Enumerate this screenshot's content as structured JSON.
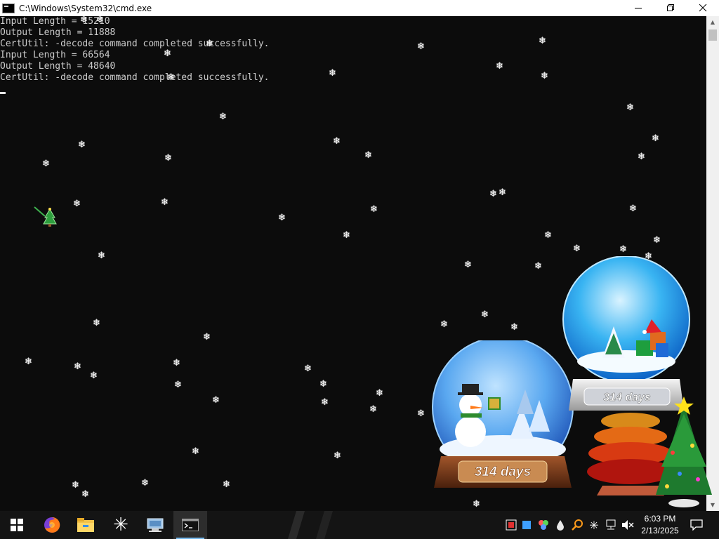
{
  "window": {
    "title": "C:\\Windows\\System32\\cmd.exe",
    "minimize_icon": "minimize-icon",
    "maximize_icon": "restore-icon",
    "close_icon": "close-icon"
  },
  "console": {
    "lines": [
      "Input Length = 15210",
      "Output Length = 11888",
      "CertUtil: -decode command completed successfully.",
      "Input Length = 66564",
      "Output Length = 48640",
      "CertUtil: -decode command completed successfully."
    ]
  },
  "gadgets": {
    "snowglobe_small": {
      "counter": "314 days"
    },
    "snowglobe_large": {
      "counter": "314 days"
    }
  },
  "taskbar": {
    "start_icon": "windows-start-icon",
    "apps": [
      {
        "icon": "firefox-icon"
      },
      {
        "icon": "file-explorer-icon"
      },
      {
        "icon": "snowflake-app-icon"
      },
      {
        "icon": "control-panel-icon"
      },
      {
        "icon": "command-prompt-icon"
      }
    ],
    "tray_icons": [
      "network-monitor-icon",
      "blue-square-icon",
      "colorful-app-icon",
      "water-drop-icon",
      "search-magnifier-icon",
      "snowflake-tray-icon",
      "network-icon",
      "volume-muted-icon"
    ],
    "time": "6:03 PM",
    "date": "2/13/2025",
    "notification_icon": "action-center-icon"
  },
  "colors": {
    "console_bg": "#0c0c0c",
    "console_text": "#cccccc",
    "taskbar_bg": "#141414",
    "accent": "#76b9ed"
  }
}
